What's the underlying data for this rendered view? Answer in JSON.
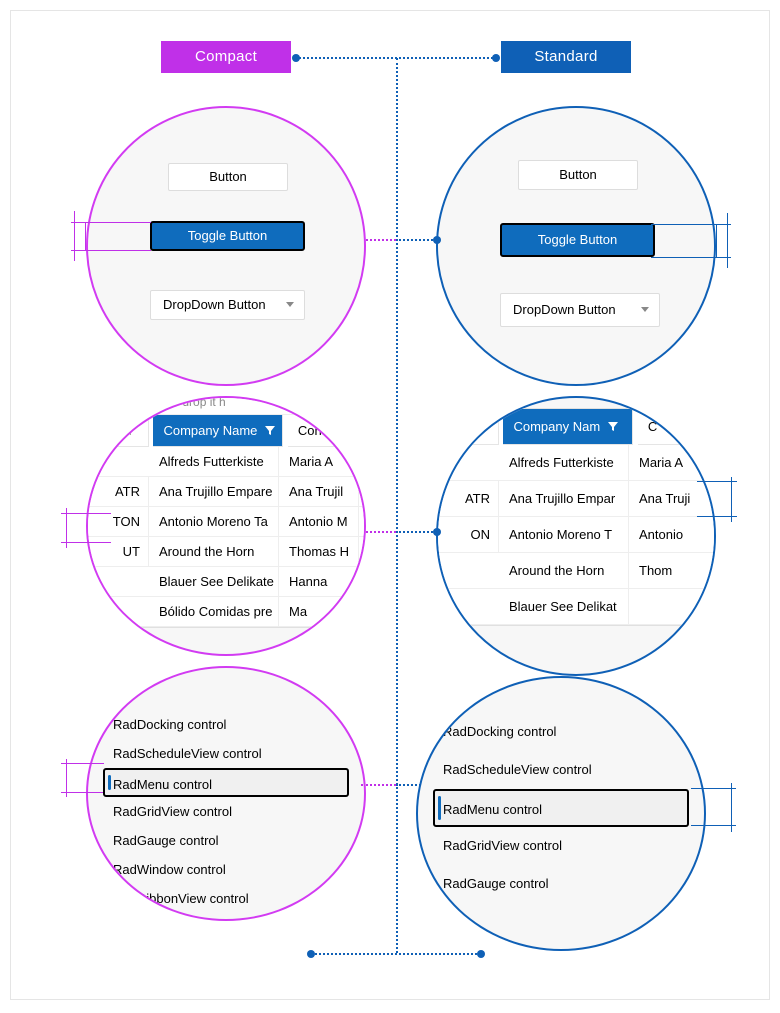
{
  "labels": {
    "compact": "Compact",
    "standard": "Standard"
  },
  "buttons": {
    "plain": "Button",
    "toggle": "Toggle Button",
    "dropdown": "DropDown Button"
  },
  "grid": {
    "header_partial": "and drop it h",
    "col_company": "Company Name",
    "col_company_sm": "Company Nam",
    "col_contact_short": "Cont",
    "col_contact_shorter": "C",
    "compact_ids": [
      "ATR",
      "TON",
      "UT"
    ],
    "standard_ids": [
      "ATR",
      "ON"
    ],
    "compact_rows": [
      {
        "company": "Alfreds Futterkiste",
        "contact": "Maria A"
      },
      {
        "company": "Ana Trujillo Empare",
        "contact": "Ana Trujil"
      },
      {
        "company": "Antonio Moreno Ta",
        "contact": "Antonio M"
      },
      {
        "company": "Around the Horn",
        "contact": "Thomas H"
      },
      {
        "company": "Blauer See Delikate",
        "contact": "Hanna"
      },
      {
        "company": "Bólido Comidas pre",
        "contact": "Ma"
      }
    ],
    "standard_rows": [
      {
        "company": "Alfreds Futterkiste",
        "contact": "Maria A"
      },
      {
        "company": "Ana Trujillo Empar",
        "contact": "Ana Truji"
      },
      {
        "company": "Antonio Moreno T",
        "contact": "Antonio"
      },
      {
        "company": "Around the Horn",
        "contact": "Thom"
      },
      {
        "company": "Blauer See Delikat",
        "contact": ""
      }
    ]
  },
  "list": {
    "compact": [
      "RadDocking control",
      "RadScheduleView control",
      "RadMenu control",
      "RadGridView control",
      "RadGauge control",
      "RadWindow control",
      "RadRibbonView control"
    ],
    "standard": [
      "RadDocking control",
      "RadScheduleView control",
      "RadMenu control",
      "RadGridView control",
      "RadGauge control"
    ],
    "selected": "RadMenu control"
  }
}
